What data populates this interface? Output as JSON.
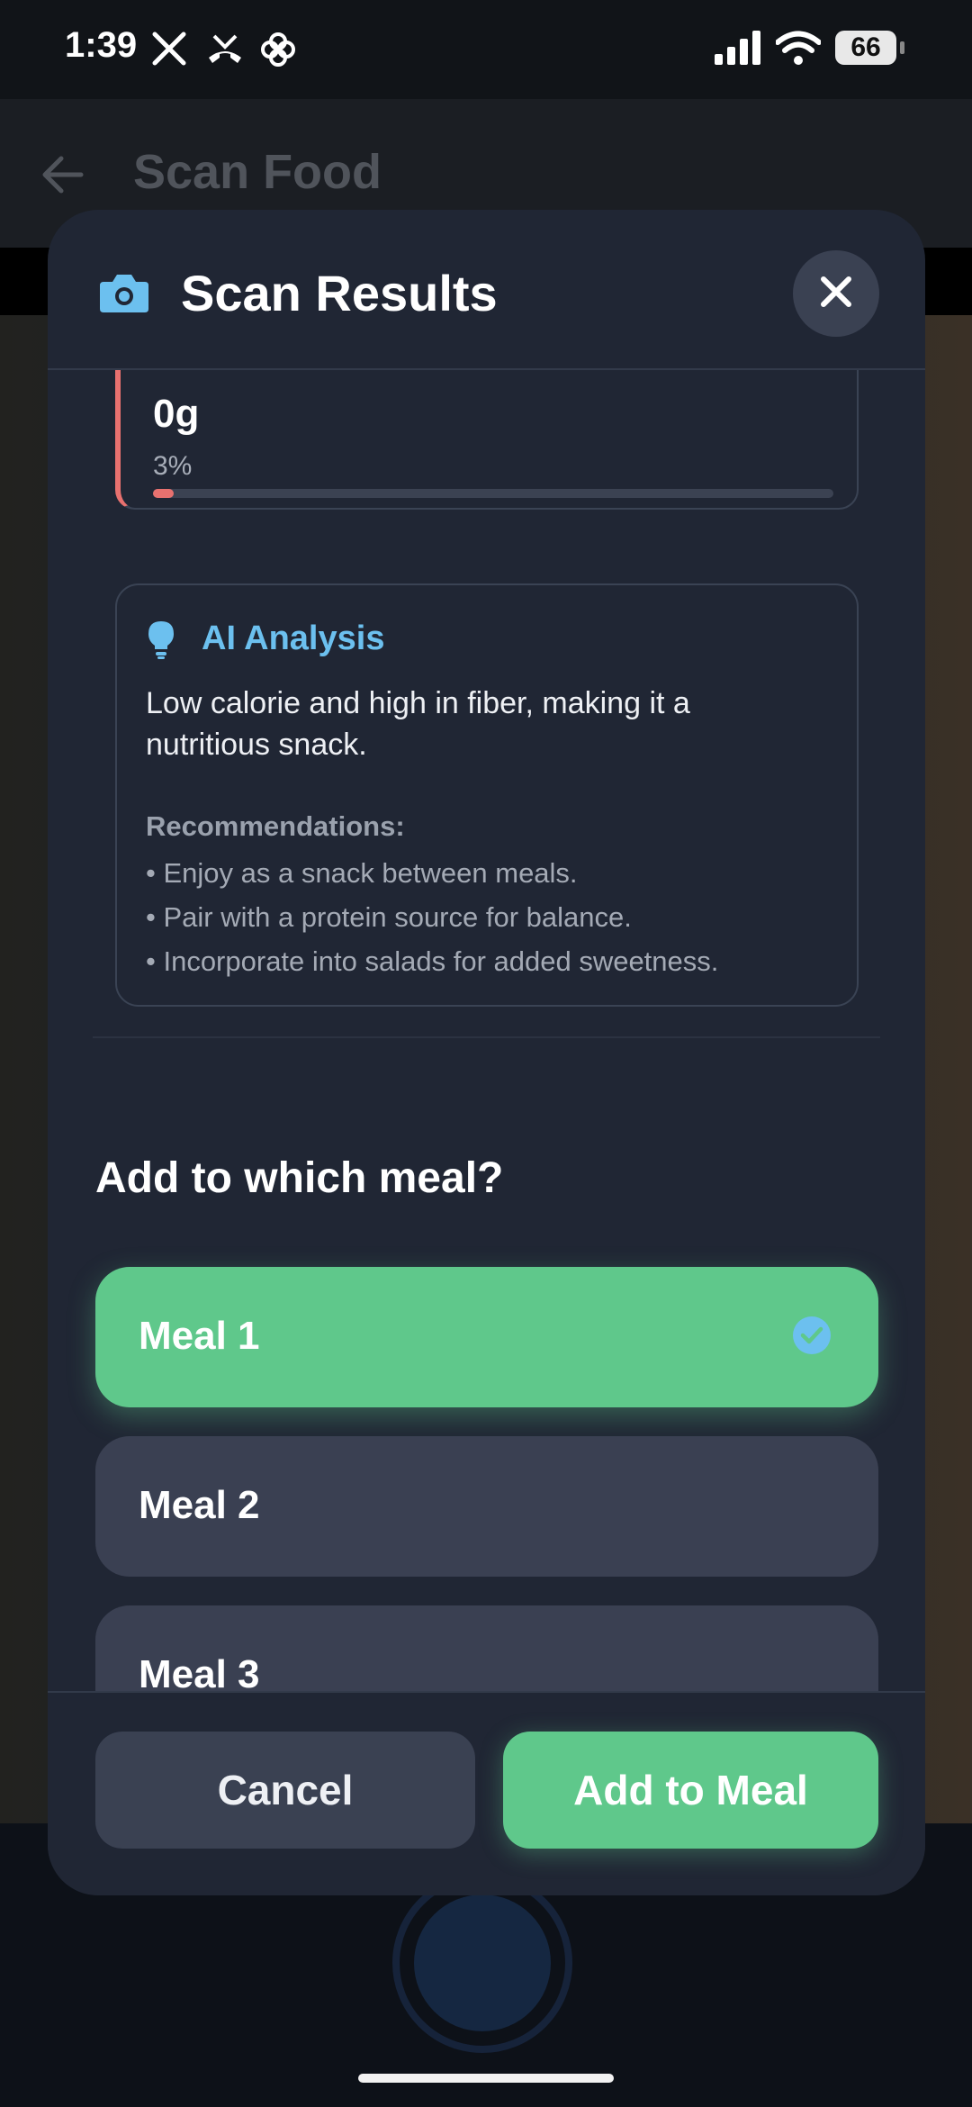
{
  "status_bar": {
    "time": "1:39",
    "battery": "66",
    "icons": [
      "x-logo-icon",
      "missed-call-icon",
      "pinwheel-icon",
      "cellular-signal-icon",
      "wifi-icon",
      "battery-icon"
    ]
  },
  "background_page": {
    "title": "Scan Food"
  },
  "modal": {
    "title": "Scan Results",
    "nutrient": {
      "value": "0g",
      "percent_label": "3%",
      "percent": 3,
      "accent_color": "#e8716f"
    },
    "ai_analysis": {
      "title": "AI Analysis",
      "summary": "Low calorie and high in fiber, making it a nutritious snack.",
      "recommendations_title": "Recommendations:",
      "recommendations": [
        "• Enjoy as a snack between meals.",
        "• Pair with a protein source for balance.",
        "• Incorporate into salads for added sweetness."
      ]
    },
    "meal_question": "Add to which meal?",
    "meals": [
      {
        "label": "Meal 1",
        "selected": true
      },
      {
        "label": "Meal 2",
        "selected": false
      },
      {
        "label": "Meal 3",
        "selected": false
      }
    ],
    "buttons": {
      "cancel": "Cancel",
      "add": "Add to Meal"
    }
  },
  "colors": {
    "accent_green": "#5fc88b",
    "accent_blue": "#6cc0ef",
    "modal_bg": "#202634"
  }
}
